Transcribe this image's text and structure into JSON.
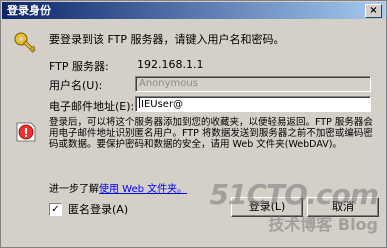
{
  "window": {
    "title": "登录身份",
    "close_label": "×"
  },
  "intro": "要登录到该 FTP 服务器，请键入用户名和密码。",
  "form": {
    "server_label": "FTP 服务器:",
    "server_value": "192.168.1.1",
    "username_label": "用户名(U):",
    "username_value": "Anonymous",
    "email_label": "电子邮件地址(E):",
    "email_value": "IEUser@"
  },
  "info": "登录后，可以将这个服务器添加到您的收藏夹，以便轻易返回。FTP 服务器会用电子邮件地址识别匿名用户。FTP 将数据发送到服务器之前不加密或编码密码或数据。要保护密码和数据的安全，请用 Web 文件夹(WebDAV)。",
  "learn_more": {
    "prefix": "进一步了解",
    "link": "使用 Web 文件夹。"
  },
  "anonymous_checkbox": {
    "label": "匿名登录(A)",
    "checked": true,
    "check_mark": "✓"
  },
  "buttons": {
    "login": "登录(L)",
    "cancel": "取消"
  },
  "watermark": {
    "line1": "51CTO.com",
    "line2": "技术博客  Blog"
  },
  "icons": [
    "key-icon",
    "info-icon",
    "close-icon",
    "check-icon"
  ]
}
